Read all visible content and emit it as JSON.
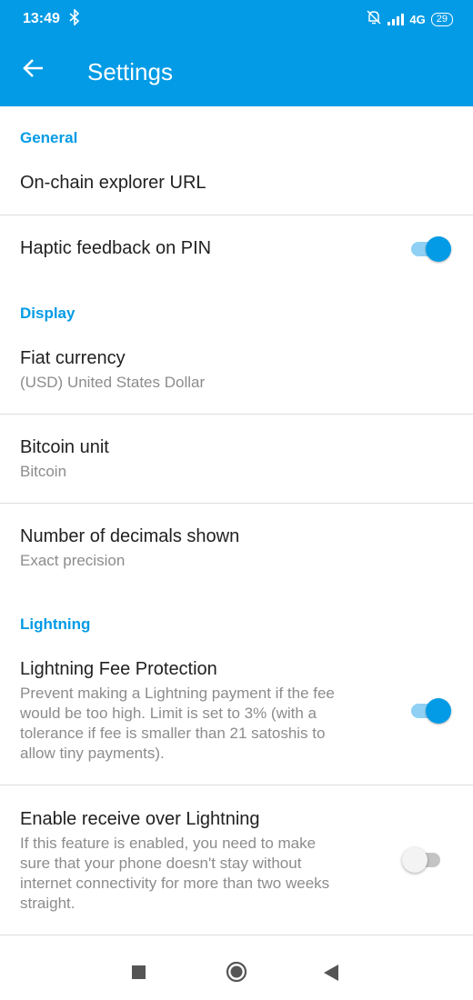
{
  "status_bar": {
    "time": "13:49",
    "network": "4G",
    "battery": "29",
    "icons": [
      "bluetooth-icon",
      "mute-bell-icon",
      "signal-icon",
      "battery-icon"
    ]
  },
  "toolbar": {
    "back_icon": "back-arrow-icon",
    "title": "Settings",
    "color": "#039be5"
  },
  "general": {
    "header": "General",
    "explorer": {
      "title": "On-chain explorer URL"
    },
    "haptic": {
      "title": "Haptic feedback on PIN",
      "enabled": true
    }
  },
  "display": {
    "header": "Display",
    "fiat": {
      "title": "Fiat currency",
      "summary": "(USD) United States Dollar"
    },
    "unit": {
      "title": "Bitcoin unit",
      "summary": "Bitcoin"
    },
    "decimals": {
      "title": "Number of decimals shown",
      "summary": "Exact precision"
    }
  },
  "lightning": {
    "header": "Lightning",
    "fee_protection": {
      "title": "Lightning Fee Protection",
      "summary_lines": [
        "Prevent making a Lightning payment if the fee",
        "would be too high. Limit is set to 3% (with a",
        "tolerance if fee is smaller than 21 satoshis to",
        "allow tiny payments)."
      ],
      "enabled": true
    },
    "receive": {
      "title": "Enable receive over Lightning",
      "summary_lines": [
        "If this feature is enabled, you need to make",
        "sure that your phone doesn't stay without",
        "internet connectivity for more than two weeks",
        "straight."
      ],
      "enabled": false
    }
  },
  "nav_bar": {
    "icons": [
      "recents-square-icon",
      "home-circle-icon",
      "back-triangle-icon"
    ]
  },
  "colors": {
    "accent": "#039be5",
    "switch_track_on": "#8fd0f4",
    "switch_off": "#c4c4c4"
  }
}
